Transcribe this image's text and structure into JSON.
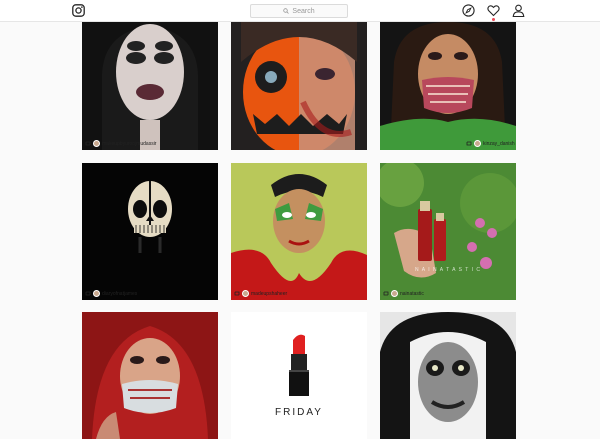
{
  "app": {
    "brand_icon": "instagram-logo-icon",
    "accent": "#ed4956"
  },
  "header": {
    "search_placeholder": "Search",
    "icons": [
      "compass-icon",
      "heart-icon",
      "profile-icon"
    ]
  },
  "feed": {
    "posts": [
      {
        "handle": "makeupbyuroojmudassir",
        "regram": true
      },
      {
        "handle": "",
        "regram": false
      },
      {
        "handle": "kinzay_danish",
        "regram": true
      },
      {
        "handle": "diaryofnatjames",
        "regram": true
      },
      {
        "handle": "madeupshaheer",
        "regram": true
      },
      {
        "handle": "nainatastic",
        "regram": true,
        "watermark": "N A I N A T A S T I C"
      },
      {
        "handle": "",
        "regram": false
      },
      {
        "handle": "",
        "regram": false,
        "caption": "FRIDAY"
      },
      {
        "handle": "",
        "regram": false
      }
    ]
  }
}
